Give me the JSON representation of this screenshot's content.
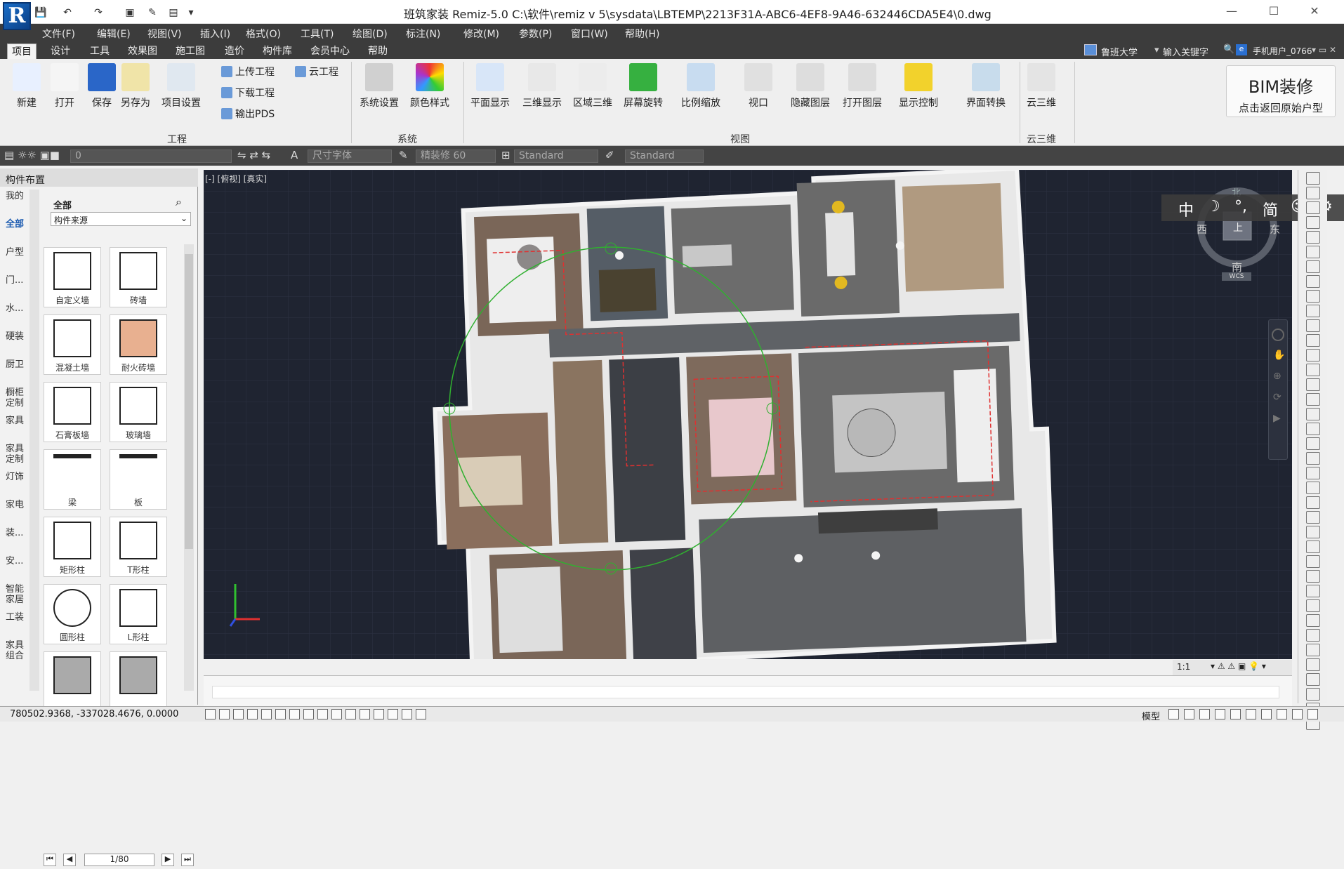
{
  "window": {
    "title": "班筑家装 Remiz-5.0     C:\\软件\\remiz v 5\\sysdata\\LBTEMP\\2213F31A-ABC6-4EF8-9A46-632446CDA5E4\\0.dwg",
    "logo_letter": "R",
    "minimize": "—",
    "maximize": "☐",
    "close": "✕"
  },
  "menus": [
    "文件(F)",
    "编辑(E)",
    "视图(V)",
    "插入(I)",
    "格式(O)",
    "工具(T)",
    "绘图(D)",
    "标注(N)",
    "修改(M)",
    "参数(P)",
    "窗口(W)",
    "帮助(H)"
  ],
  "tabs": [
    "项目",
    "设计",
    "工具",
    "效果图",
    "施工图",
    "造价",
    "构件库",
    "会员中心",
    "帮助"
  ],
  "active_tab": "项目",
  "right_controls": {
    "org": "鲁班大学",
    "search_placeholder": "输入关键字",
    "user": "手机用户_0766"
  },
  "ribbon": {
    "project_buttons": [
      "新建",
      "打开",
      "保存",
      "另存为",
      "项目设置"
    ],
    "project_small": [
      "上传工程",
      "下载工程",
      "输出PDS",
      "云工程"
    ],
    "group_project": "工程",
    "system_buttons": [
      "系统设置",
      "颜色样式"
    ],
    "group_system": "系统",
    "view_buttons": [
      "平面显示",
      "三维显示",
      "区域三维",
      "屏幕旋转",
      "比例缩放",
      "视口",
      "隐藏图层",
      "打开图层",
      "显示控制",
      "界面转换"
    ],
    "group_view": "视图",
    "cloud_buttons": [
      "云三维"
    ],
    "group_cloud": "云三维",
    "bim_title": "BIM装修",
    "bim_sub": "点击返回原始户型"
  },
  "propbar": {
    "layer": "0",
    "font_style": "尺寸字体",
    "precision": "精装修 60",
    "dim_style": "Standard",
    "table_style": "Standard"
  },
  "left_panel": {
    "title": "构件布置",
    "categories": [
      "我的",
      "全部",
      "户型",
      "门...",
      "水...",
      "硬装",
      "厨卫",
      "橱柜\n定制",
      "家具",
      "家具\n定制",
      "灯饰",
      "家电",
      "装...",
      "安...",
      "智能\n家居",
      "工装",
      "家具\n组合"
    ],
    "active_category": "全部",
    "filter_label": "全部",
    "source_select": "构件来源",
    "components": [
      "自定义墙",
      "砖墙",
      "混凝土墙",
      "耐火砖墙",
      "石膏板墙",
      "玻璃墙",
      "梁",
      "板",
      "矩形柱",
      "T形柱",
      "圆形柱",
      "L形柱",
      "",
      ""
    ],
    "page": "1/80"
  },
  "viewport": {
    "label": "[-] [俯视] [真实]",
    "compass": {
      "north": "北",
      "south": "南",
      "east": "东",
      "west": "西",
      "top": "上",
      "wcs": "WCS"
    },
    "scale": "1:1"
  },
  "ime": [
    "中",
    "☽",
    "°,",
    "简",
    "☺",
    "⚙"
  ],
  "status": {
    "coords": "780502.9368,  -337028.4676,  0.0000",
    "mode": "模型"
  },
  "colors": {
    "accent": "#1a6ec8",
    "dark_bar": "#3c3c3c",
    "viewport_bg": "#1f2431"
  }
}
